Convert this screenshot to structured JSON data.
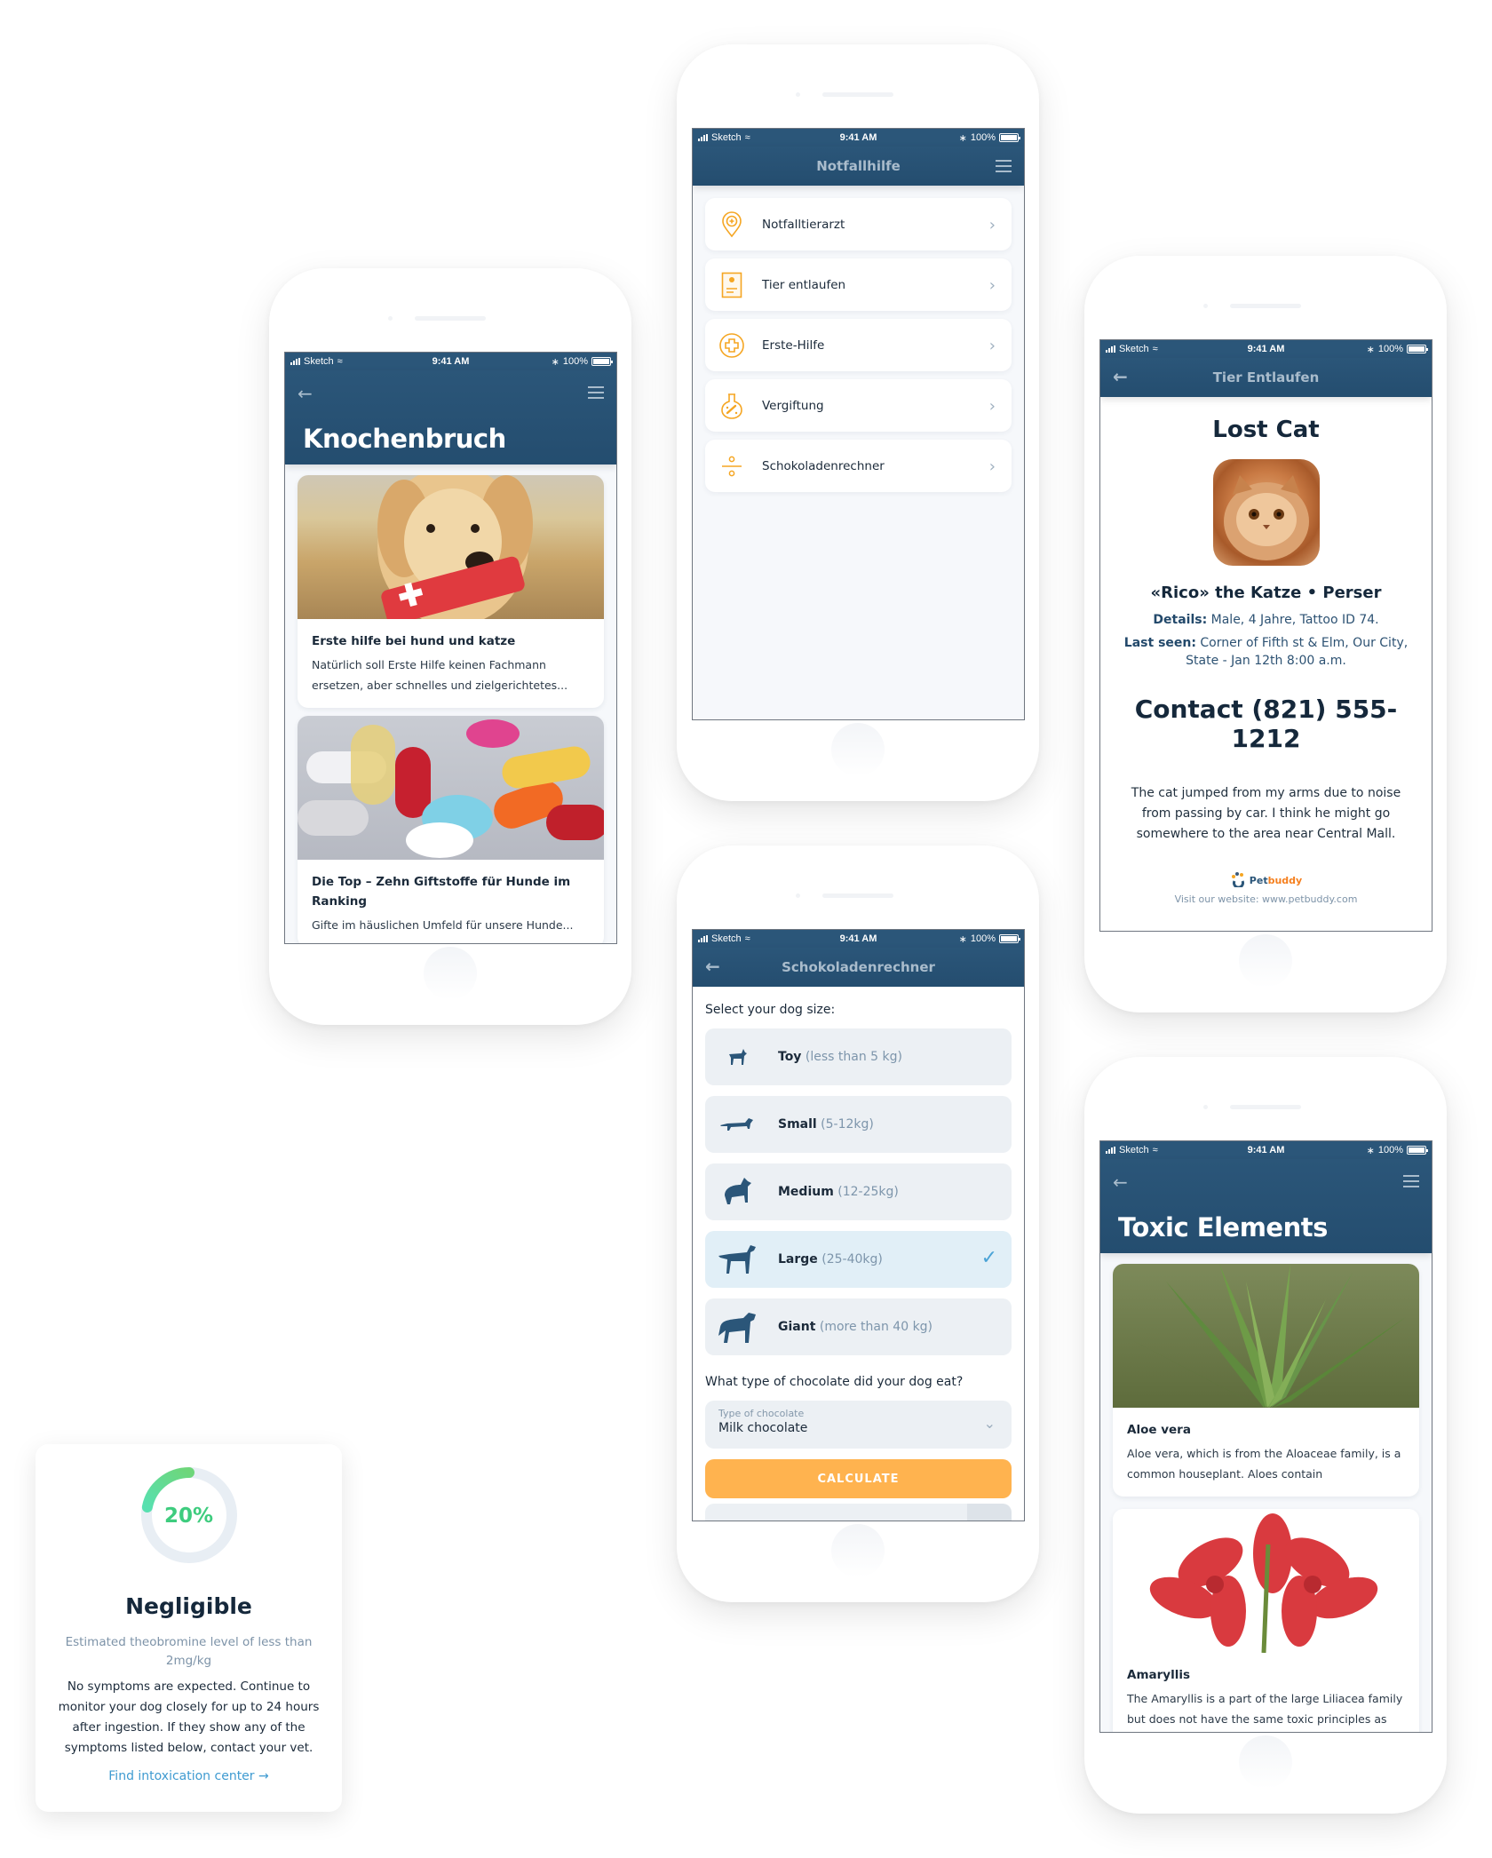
{
  "status_bar": {
    "carrier": "Sketch",
    "time": "9:41 AM",
    "battery": "100%"
  },
  "knochenbruch": {
    "title": "Knochenbruch",
    "articles": [
      {
        "title": "Erste hilfe bei hund und katze",
        "excerpt": "Natürlich soll Erste Hilfe keinen Fachmann ersetzen, aber schnelles und zielgerichtetes...",
        "image": "dog-with-first-aid-kit"
      },
      {
        "title": "Die Top – Zehn Giftstoffe für Hunde im Ranking",
        "excerpt": "Gifte im häuslichen Umfeld für unsere Hunde...",
        "image": "pills"
      }
    ]
  },
  "notfallhilfe": {
    "title": "Notfallhilfe",
    "items": [
      {
        "label": "Notfalltierarzt",
        "icon": "location-pin-plus-icon"
      },
      {
        "label": "Tier entlaufen",
        "icon": "paw-poster-icon"
      },
      {
        "label": "Erste-Hilfe",
        "icon": "first-aid-cross-icon"
      },
      {
        "label": "Vergiftung",
        "icon": "poison-flask-icon"
      },
      {
        "label": "Schokoladenrechner",
        "icon": "divide-icon"
      }
    ]
  },
  "lost_cat": {
    "nav_title": "Tier Entlaufen",
    "heading": "Lost Cat",
    "name": "«Rico» the Katze • Perser",
    "details_label": "Details:",
    "details": "Male, 4 Jahre, Tattoo ID 74.",
    "last_seen_label": "Last seen:",
    "last_seen": "Corner of Fifth st & Elm, Our City, State -  Jan 12th 8:00 a.m.",
    "contact": "Contact (821) 555-1212",
    "description": "The cat jumped from my arms due to noise from passing by car. I think he might go somewhere to the area near Central Mall.",
    "brand_pet": "Pet",
    "brand_buddy": "buddy",
    "website": "Visit our website: www.petbuddy.com"
  },
  "chocolate_calc": {
    "nav_title": "Schokoladenrechner",
    "size_question": "Select your dog size:",
    "sizes": [
      {
        "name": "Toy",
        "range": "(less than 5 kg)",
        "selected": false
      },
      {
        "name": "Small",
        "range": "(5-12kg)",
        "selected": false
      },
      {
        "name": "Medium",
        "range": "(12-25kg)",
        "selected": false
      },
      {
        "name": "Large",
        "range": "(25-40kg)",
        "selected": true
      },
      {
        "name": "Giant",
        "range": "(more than 40 kg)",
        "selected": false
      }
    ],
    "choc_question": "What type of chocolate did your dog eat?",
    "choc_select_label": "Type of chocolate",
    "choc_select_value": "Milk chocolate",
    "calculate_label": "CALCULATE"
  },
  "toxic": {
    "title": "Toxic Elements",
    "items": [
      {
        "title": "Aloe vera",
        "excerpt": "Aloe vera, which is from the Aloaceae family, is a common houseplant. Aloes contain",
        "image": "aloe-vera-plant"
      },
      {
        "title": "Amaryllis",
        "excerpt": "The Amaryllis is a part of the large Liliacea family but does not have the same toxic principles as",
        "image": "amaryllis-flower"
      }
    ]
  },
  "result": {
    "percent_label": "20%",
    "percent_value": 0.2,
    "level": "Negligible",
    "estimate": "Estimated theobromine level of less than 2mg/kg",
    "message": "No symptoms are expected. Continue to monitor your dog closely for up to 24 hours after ingestion. If they show any of the symptoms listed below, contact your vet.",
    "link": "Find intoxication center"
  },
  "colors": {
    "navbar": "#2b5679",
    "accent_orange": "#ffb34f",
    "accent_green": "#3ecc7e",
    "link_blue": "#3f9bd1",
    "selected_bg": "#e1eff7"
  }
}
